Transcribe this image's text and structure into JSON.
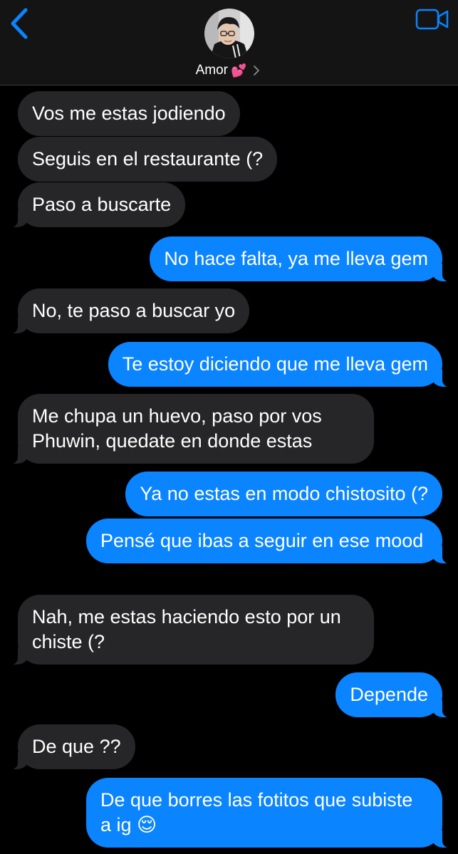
{
  "header": {
    "contact_name": "Amor",
    "contact_emoji": "💕",
    "back_icon": "chevron-left-icon",
    "video_icon": "video-camera-icon",
    "accent_color": "#0a84ff"
  },
  "messages": [
    {
      "side": "in",
      "text": "Vos me estas jodiendo"
    },
    {
      "side": "in",
      "text": "Seguis en el restaurante (?"
    },
    {
      "side": "in",
      "text": "Paso a buscarte"
    },
    {
      "side": "out",
      "text": "No hace falta, ya me lleva gem"
    },
    {
      "side": "in",
      "text": "No, te paso a buscar yo"
    },
    {
      "side": "out",
      "text": "Te estoy diciendo que me lleva gem"
    },
    {
      "side": "in",
      "text": "Me chupa un huevo, paso por vos Phuwin, quedate en donde estas"
    },
    {
      "side": "out",
      "text": "Ya no estas en modo chistosito (?"
    },
    {
      "side": "out",
      "text": "Pensé que ibas a seguir en ese mood"
    },
    {
      "side": "in",
      "text": "Nah, me estas haciendo esto por un chiste (?"
    },
    {
      "side": "out",
      "text": "Depende"
    },
    {
      "side": "in",
      "text": "De que ??"
    },
    {
      "side": "out",
      "text": "De que borres las fotitos que subiste a ig 😌"
    }
  ],
  "colors": {
    "incoming_bubble": "#262628",
    "outgoing_bubble": "#0a84ff",
    "background": "#000000"
  }
}
